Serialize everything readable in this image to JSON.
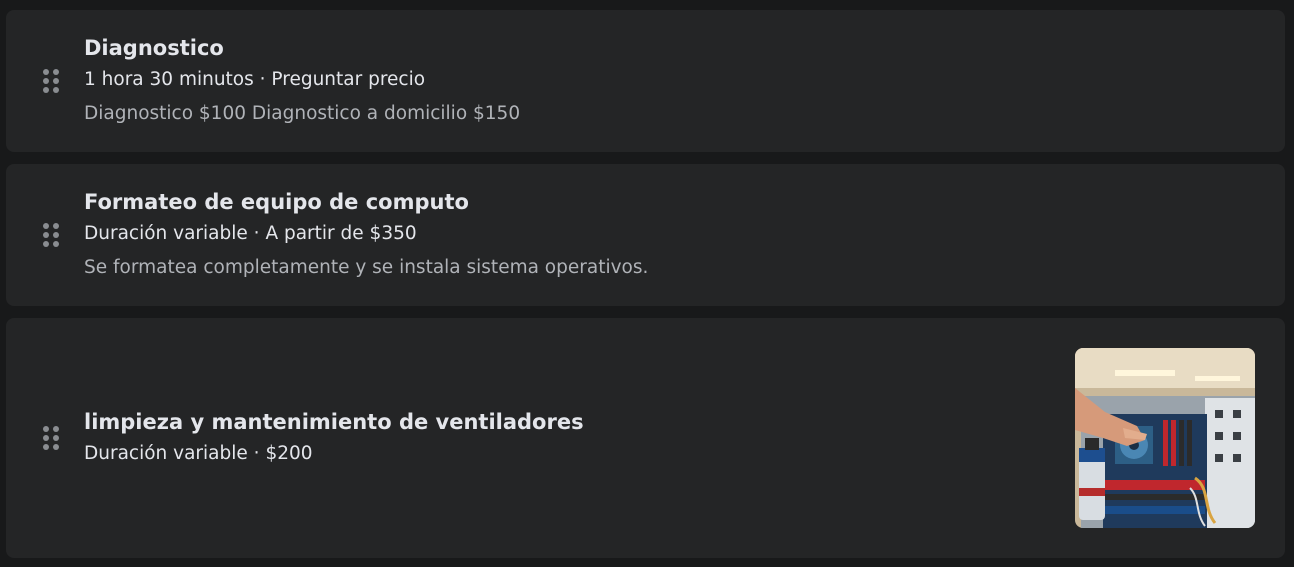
{
  "services": [
    {
      "title": "Diagnostico",
      "duration": "1 hora 30 minutos",
      "separator": " · ",
      "price": "Preguntar precio",
      "description": "Diagnostico $100 Diagnostico a domicilio $150"
    },
    {
      "title": "Formateo de equipo de computo",
      "duration": "Duración variable",
      "separator": " · ",
      "price": "A partir de $350",
      "description": "Se formatea completamente y se instala sistema operativos."
    },
    {
      "title": "limpieza y mantenimiento de ventiladores",
      "duration": "Duración variable",
      "separator": " · ",
      "price": "$200",
      "image_icon": "computer-cleaning-photo"
    }
  ],
  "colors": {
    "background": "#18191a",
    "card": "#242526",
    "primary_text": "#e4e6eb",
    "secondary_text": "#b0b3b8",
    "handle_dots": "#8a8d91"
  }
}
